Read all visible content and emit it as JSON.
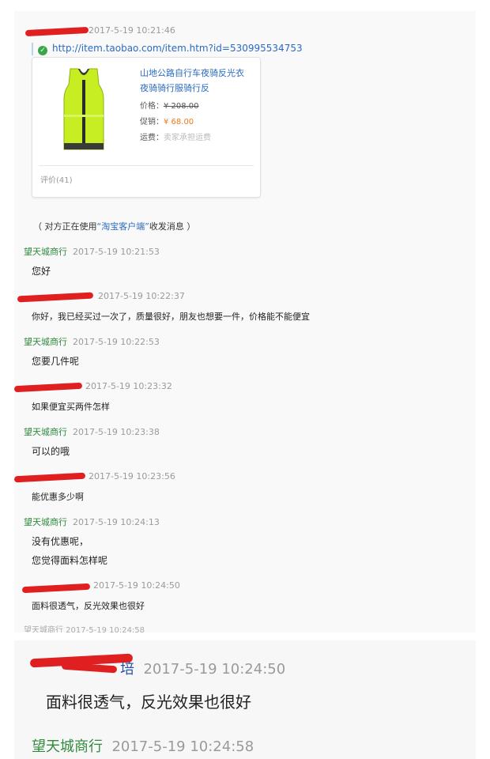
{
  "chat": {
    "first_time": "2017-5-19 10:21:46",
    "product_link": "http://item.taobao.com/item.htm?id=530995534753",
    "product_card": {
      "title": "山地公路自行车夜骑反光衣夜骑骑行服骑行反",
      "price_label": "价格：",
      "price_value": "¥ 208.00",
      "promo_label": "促销：",
      "promo_value": "¥ 68.00",
      "shipping_label": "运费：",
      "shipping_value": "卖家承担运费",
      "reviews": "评价(41)"
    },
    "notice_prefix": "（ 对方正在使用",
    "notice_client": "“淘宝客户端”",
    "notice_suffix": "收发消息 ）",
    "messages": [
      {
        "sender": "望天城商行",
        "time": "2017-5-19 10:21:53",
        "text": "您好"
      },
      {
        "sender": "",
        "time": "2017-5-19 10:22:37",
        "text": "你好，我已经买过一次了，质量很好，朋友也想要一件，价格能不能便宜"
      },
      {
        "sender": "望天城商行",
        "time": "2017-5-19 10:22:53",
        "text": "您要几件呢"
      },
      {
        "sender": "",
        "time": "2017-5-19 10:23:32",
        "text": "如果便宜买两件怎样"
      },
      {
        "sender": "望天城商行",
        "time": "2017-5-19 10:23:38",
        "text": "可以的哦"
      },
      {
        "sender": "",
        "time": "2017-5-19 10:23:56",
        "text": "能优惠多少啊"
      },
      {
        "sender": "望天城商行",
        "time": "2017-5-19 10:24:13",
        "text": "没有优惠呢，",
        "text2": "您觉得面料怎样呢"
      },
      {
        "sender": "",
        "time": "2017-5-19 10:24:50",
        "text": "面料很透气，反光效果也很好"
      }
    ],
    "cut_line": "望天城商行 2017-5-19 10:24:58"
  },
  "zoom": {
    "customer_suffix": "培",
    "customer_time": "2017-5-19 10:24:50",
    "customer_text": "面料很透气，反光效果也很好",
    "shop_sender": "望天城商行",
    "shop_time": "2017-5-19 10:24:58"
  },
  "colors": {
    "shop_name": "#2f8a3c",
    "link": "#2a6bc0",
    "redaction": "#e02020",
    "promo": "#f07a1a"
  }
}
